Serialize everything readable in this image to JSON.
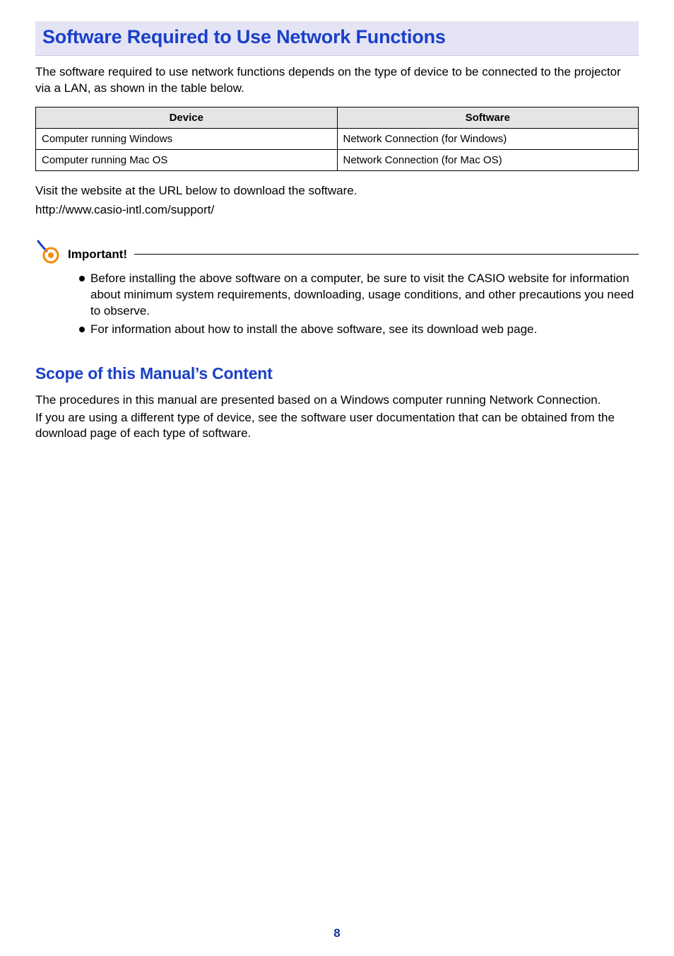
{
  "h1": "Software Required to Use Network Functions",
  "intro": "The software required to use network functions depends on the type of device to be connected to the projector via a LAN, as shown in the table below.",
  "table": {
    "headers": {
      "device": "Device",
      "software": "Software"
    },
    "rows": [
      {
        "device": "Computer running Windows",
        "software": "Network Connection (for Windows)"
      },
      {
        "device": "Computer running Mac OS",
        "software": "Network Connection (for Mac OS)"
      }
    ]
  },
  "visit_line": "Visit the website at the URL below to download the software.",
  "url": "http://www.casio-intl.com/support/",
  "important": {
    "label": "Important!",
    "bullets": [
      "Before installing the above software on a computer, be sure to visit the CASIO website for information about minimum system requirements, downloading, usage conditions, and other precautions you need to observe.",
      "For information about how to install the above software, see its download web page."
    ]
  },
  "h2": "Scope of this Manual’s Content",
  "scope_para1": "The procedures in this manual are presented based on a Windows computer running Network Connection.",
  "scope_para2": "If you are using a different type of device, see the software user documentation that can be obtained from the download page of each type of software.",
  "page_number": "8"
}
